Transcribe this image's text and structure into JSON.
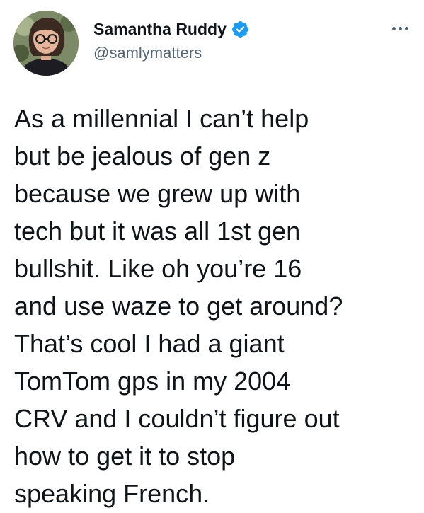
{
  "author": {
    "display_name": "Samantha Ruddy",
    "handle": "@samlymatters",
    "verified": true,
    "avatar_icon": "profile-photo",
    "verified_icon": "verified-badge-icon"
  },
  "menu": {
    "icon": "more-horizontal-icon"
  },
  "tweet": {
    "lines": [
      "As a millennial I can’t help",
      "but be jealous of gen z",
      "because we grew up with",
      "tech but it was all 1st gen",
      "bullshit. Like oh you’re 16",
      "and use waze to get around?",
      "That’s cool I had a giant",
      "TomTom gps in my 2004",
      "CRV and I couldn’t figure out",
      "how to get it to stop",
      "speaking French."
    ]
  },
  "colors": {
    "text": "#0f1419",
    "secondary": "#536471",
    "verified": "#1d9bf0",
    "background": "#ffffff"
  }
}
